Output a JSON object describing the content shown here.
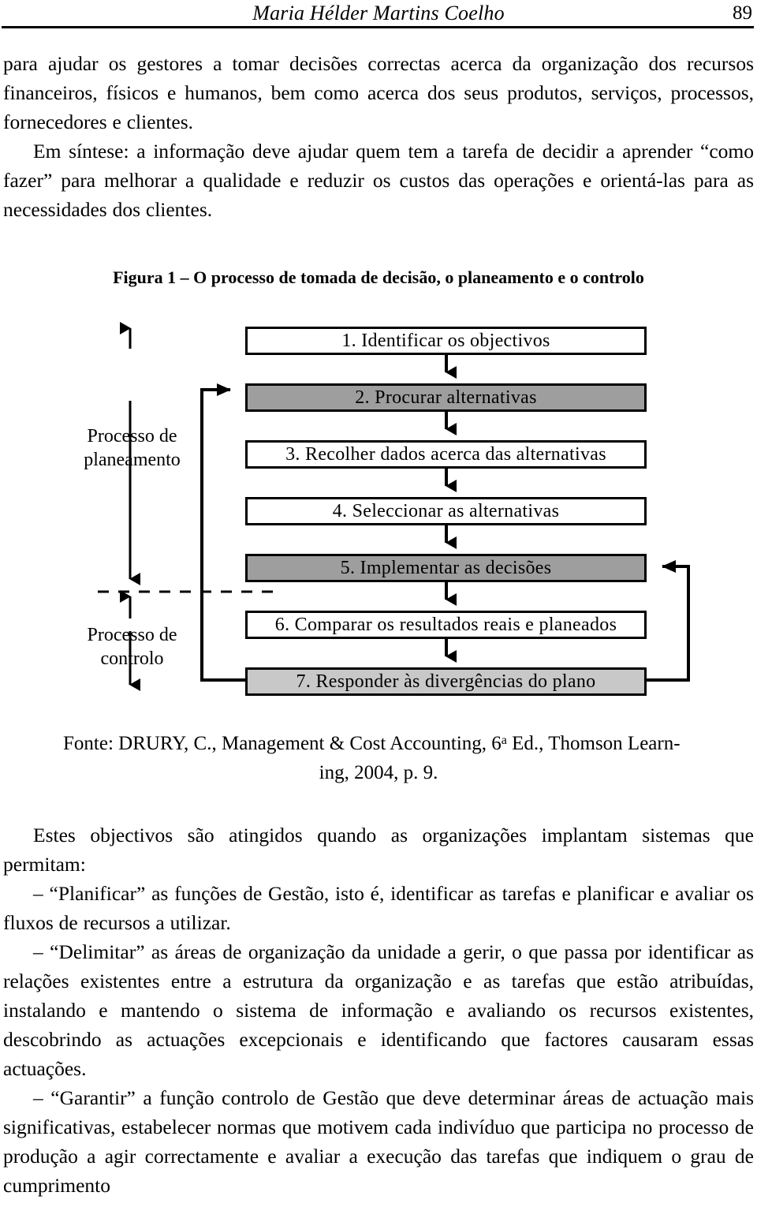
{
  "header": {
    "title": "Maria Hélder Martins Coelho",
    "page_number": "89"
  },
  "paragraphs": {
    "top": [
      "para ajudar os gestores a tomar decisões correctas acerca da organização dos recursos financeiros, físicos e humanos, bem como acerca dos seus produtos, serviços, processos, fornecedores e clientes.",
      "Em síntese: a informação deve ajudar quem tem a tarefa de decidir a aprender “como fazer” para melhorar a qualidade e reduzir os custos das operações e orientá-las para as necessidades dos clientes."
    ],
    "after": [
      "Estes objectivos são atingidos quando as organizações implantam sistemas que permitam:",
      "– “Planificar” as funções de Gestão, isto é, identificar as tarefas e planificar e avaliar os fluxos de recursos a utilizar.",
      "– “Delimitar” as áreas de organização da unidade a gerir, o que passa por identificar as relações existentes entre a estrutura da organização e as tarefas que estão atribuídas, instalando e mantendo o sistema de informação e avaliando os recursos existentes, descobrindo as actuações excepcionais e identificando que factores causaram essas actuações.",
      "– “Garantir” a função controlo de Gestão que deve determinar áreas de actuação mais significativas, estabelecer normas que motivem cada indivíduo que participa no processo de produção a agir correctamente e avaliar a execução das tarefas que indiquem o grau de cumprimento"
    ]
  },
  "figure": {
    "caption": "Figura 1 – O processo de tomada de decisão, o planeamento e o controlo",
    "side_labels": {
      "planning": "Processo de\nplaneamento",
      "planning_line1": "Processo de",
      "planning_line2": "planeamento",
      "control_line1": "Processo de",
      "control_line2": "controlo"
    },
    "steps": [
      {
        "label": "1. Identificar os objectivos",
        "fill": "white"
      },
      {
        "label": "2. Procurar alternativas",
        "fill": "gray"
      },
      {
        "label": "3. Recolher dados acerca das alternativas",
        "fill": "white"
      },
      {
        "label": "4. Seleccionar as alternativas",
        "fill": "white"
      },
      {
        "label": "5. Implementar as decisões",
        "fill": "gray"
      },
      {
        "label": "6. Comparar os resultados reais e planeados",
        "fill": "white"
      },
      {
        "label": "7. Responder às divergências do plano",
        "fill": "light"
      }
    ],
    "colors": {
      "box_gray": "#9e9e9e",
      "box_light_gray": "#c8c8c8",
      "line": "#000000"
    },
    "source": {
      "line1": "Fonte: DRURY, C., Management & Cost Accounting, 6",
      "sup": "a",
      "line1b": " Ed., Thomson Learn-",
      "line2": "ing, 2004, p. 9."
    }
  }
}
